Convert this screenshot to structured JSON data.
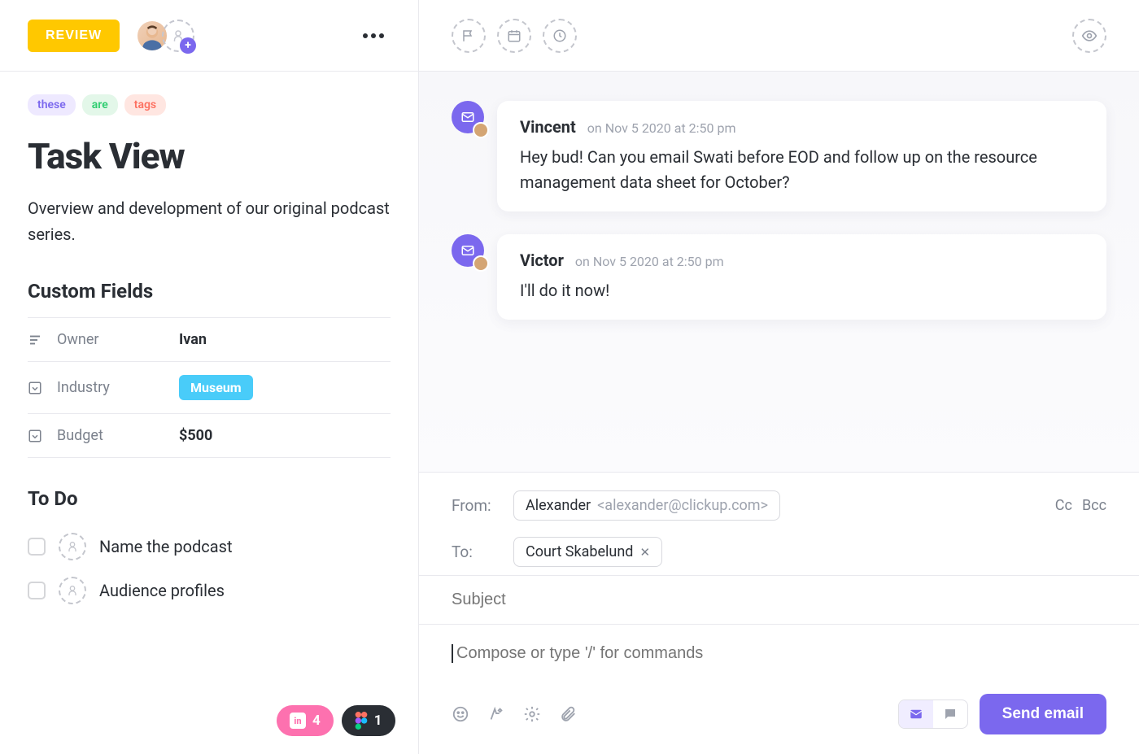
{
  "header": {
    "status": "REVIEW"
  },
  "tags": [
    {
      "label": "these",
      "cls": "purple"
    },
    {
      "label": "are",
      "cls": "green"
    },
    {
      "label": "tags",
      "cls": "red"
    }
  ],
  "task": {
    "title": "Task View",
    "description": "Overview and development of our original podcast series."
  },
  "custom_fields": {
    "heading": "Custom Fields",
    "rows": [
      {
        "icon": "list",
        "label": "Owner",
        "value": "Ivan",
        "type": "text"
      },
      {
        "icon": "dropdown",
        "label": "Industry",
        "value": "Museum",
        "type": "badge"
      },
      {
        "icon": "dropdown",
        "label": "Budget",
        "value": "$500",
        "type": "text"
      }
    ]
  },
  "todo": {
    "heading": "To Do",
    "items": [
      {
        "label": "Name the podcast"
      },
      {
        "label": "Audience profiles"
      }
    ]
  },
  "messages": [
    {
      "author": "Vincent",
      "time": "on Nov 5 2020 at 2:50 pm",
      "body": "Hey bud! Can you email Swati before EOD and follow up on the resource management data sheet for October?"
    },
    {
      "author": "Victor",
      "time": "on Nov 5 2020 at 2:50 pm",
      "body": "I'll do it now!"
    }
  ],
  "compose": {
    "from_label": "From:",
    "from_name": "Alexander",
    "from_email": "<alexander@clickup.com>",
    "to_label": "To:",
    "to_chip": "Court Skabelund",
    "cc": "Cc",
    "bcc": "Bcc",
    "subject_placeholder": "Subject",
    "body_placeholder": "Compose or type '/' for commands",
    "send": "Send email"
  },
  "attachments": {
    "invision_count": "4",
    "figma_count": "1"
  }
}
